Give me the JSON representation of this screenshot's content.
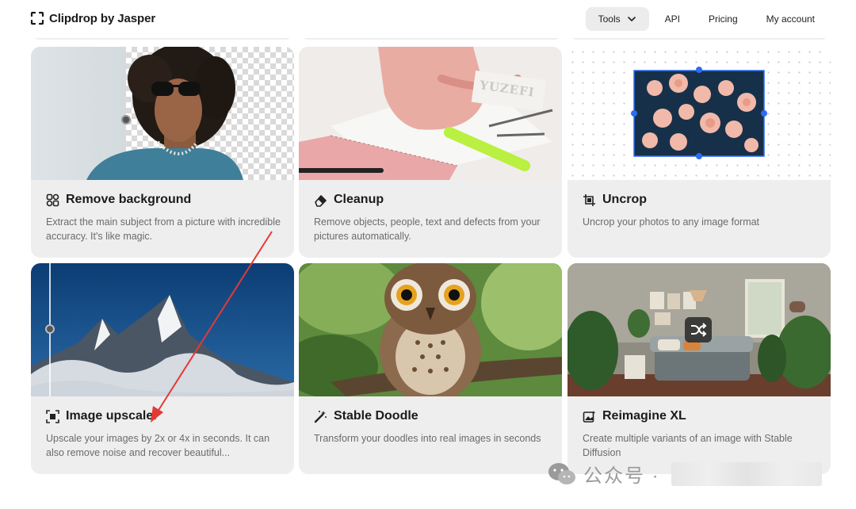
{
  "header": {
    "brand": "Clipdrop by Jasper",
    "nav": [
      {
        "label": "Tools",
        "has_dropdown": true,
        "icon": "chevron-down-icon"
      },
      {
        "label": "API"
      },
      {
        "label": "Pricing"
      },
      {
        "label": "My account"
      }
    ]
  },
  "cards": [
    {
      "title": "Remove background",
      "icon": "remove-background-icon",
      "description": "Extract the main subject from a picture with incredible accuracy. It's like magic."
    },
    {
      "title": "Cleanup",
      "icon": "eraser-icon",
      "description": "Remove objects, people, text and defects from your pictures automatically."
    },
    {
      "title": "Uncrop",
      "icon": "crop-icon",
      "description": "Uncrop your photos to any image format"
    },
    {
      "title": "Image upscaler",
      "icon": "upscale-icon",
      "description": "Upscale your images by 2x or 4x in seconds. It can also remove noise and recover beautiful..."
    },
    {
      "title": "Stable Doodle",
      "icon": "magic-wand-icon",
      "description": "Transform your doodles into real images in seconds"
    },
    {
      "title": "Reimagine XL",
      "icon": "image-variants-icon",
      "description": "Create multiple variants of an image with Stable Diffusion"
    }
  ],
  "thumb_text": {
    "cleanup_sign": "YUZEFI"
  },
  "watermark": {
    "text": "公众号 ·"
  },
  "colors": {
    "card_bg": "#eeeeee",
    "accent_handle": "#2d6cf0",
    "annotation_arrow": "#e53935"
  }
}
